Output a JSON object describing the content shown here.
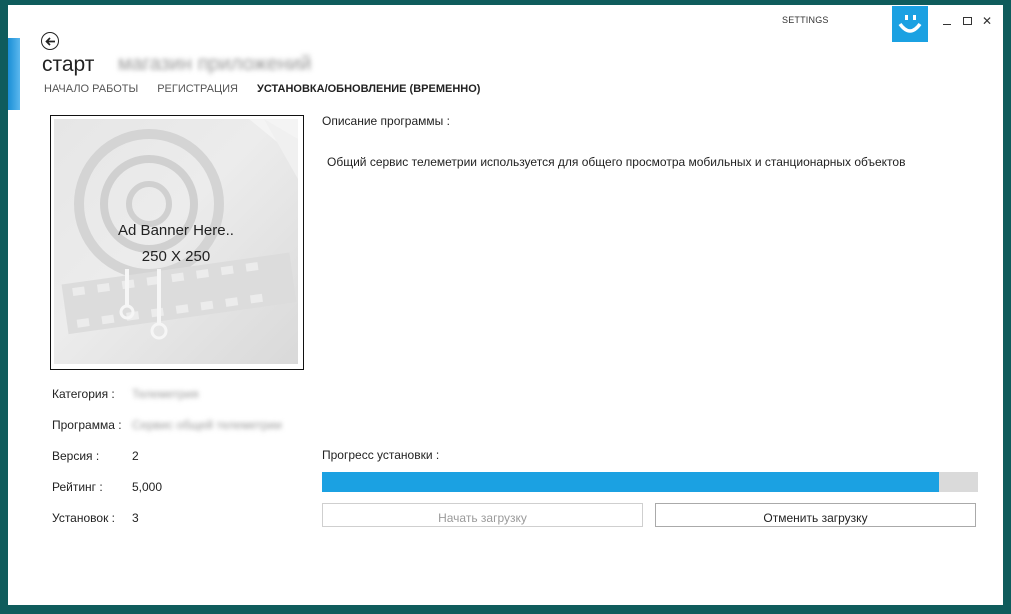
{
  "window": {
    "settings_label": "SETTINGS",
    "accent_color": "#1ba1e2"
  },
  "header": {
    "title": "старт",
    "subtitle": "магазин приложений",
    "tabs": [
      {
        "label": "НАЧАЛО РАБОТЫ",
        "active": false
      },
      {
        "label": "РЕГИСТРАЦИЯ",
        "active": false
      },
      {
        "label": "УСТАНОВКА/ОБНОВЛЕНИЕ (ВРЕМЕННО)",
        "active": true
      }
    ]
  },
  "banner": {
    "line1": "Ad Banner Here..",
    "line2": "250 X 250"
  },
  "details": {
    "category_label": "Категория :",
    "category_value": "Телеметрия",
    "program_label": "Программа :",
    "program_value": "Сервис общей телеметрии",
    "version_label": "Версия :",
    "version_value": "2",
    "rating_label": "Рейтинг :",
    "rating_value": "5,000",
    "installs_label": "Установок :",
    "installs_value": "3"
  },
  "description": {
    "label": "Описание программы :",
    "text": "Общий сервис телеметрии используется для общего просмотра мобильных и станционарных объектов"
  },
  "progress": {
    "label": "Прогресс установки :",
    "percent": 94,
    "fill_color": "#1ba1e2",
    "track_color": "#dadada"
  },
  "buttons": {
    "start_label": "Начать загрузку",
    "cancel_label": "Отменить загрузку"
  }
}
